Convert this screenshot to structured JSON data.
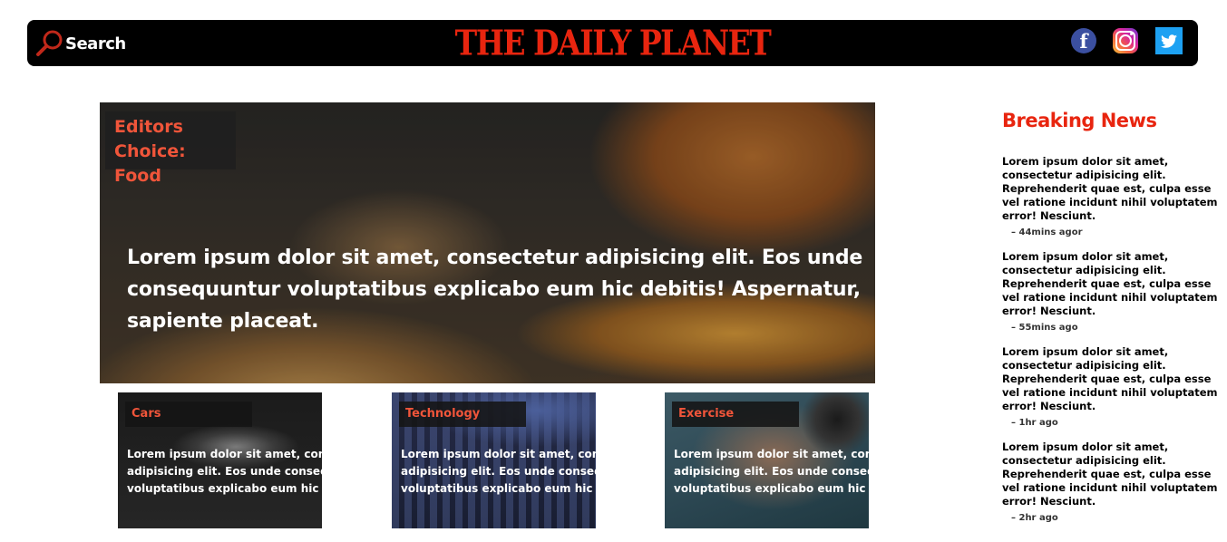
{
  "header": {
    "search_label": "Search",
    "brand": "THE DAILY PLANET",
    "social": [
      "facebook",
      "instagram",
      "twitter"
    ]
  },
  "hero": {
    "tag": "Editors Choice: Food",
    "text": "Lorem ipsum dolor sit amet, consectetur adipisicing elit. Eos unde consequuntur voluptatibus explicabo eum hic debitis! Aspernatur, sapiente placeat."
  },
  "cards": [
    {
      "tag": "Cars",
      "text_lines": [
        "Lorem ipsum dolor sit amet, consecte",
        "adipisicing elit. Eos unde consequunt",
        "voluptatibus explicabo eum hic debitis"
      ]
    },
    {
      "tag": "Technology",
      "text_lines": [
        "Lorem ipsum dolor sit amet, consecte",
        "adipisicing elit. Eos unde consequunt",
        "voluptatibus explicabo eum hic debitis"
      ]
    },
    {
      "tag": "Exercise",
      "text_lines": [
        "Lorem ipsum dolor sit amet, consecte",
        "adipisicing elit. Eos unde consequunt",
        "voluptatibus explicabo eum hic debitis"
      ]
    }
  ],
  "breaking_news": {
    "title": "Breaking News",
    "items": [
      {
        "text": "Lorem ipsum dolor sit amet, consectetur adipisicing elit. Reprehenderit quae est, culpa esse vel ratione incidunt nihil voluptatem error! Nesciunt.",
        "time": "– 44mins agor"
      },
      {
        "text": "Lorem ipsum dolor sit amet, consectetur adipisicing elit. Reprehenderit quae est, culpa esse vel ratione incidunt nihil voluptatem error! Nesciunt.",
        "time": "– 55mins ago"
      },
      {
        "text": "Lorem ipsum dolor sit amet, consectetur adipisicing elit. Reprehenderit quae est, culpa esse vel ratione incidunt nihil voluptatem error! Nesciunt.",
        "time": "– 1hr ago"
      },
      {
        "text": "Lorem ipsum dolor sit amet, consectetur adipisicing elit. Reprehenderit quae est, culpa esse vel ratione incidunt nihil voluptatem error! Nesciunt.",
        "time": "– 2hr ago"
      }
    ]
  },
  "colors": {
    "brand": "#e8250f",
    "tag_text": "#f0553a",
    "header_bg": "#000000"
  }
}
